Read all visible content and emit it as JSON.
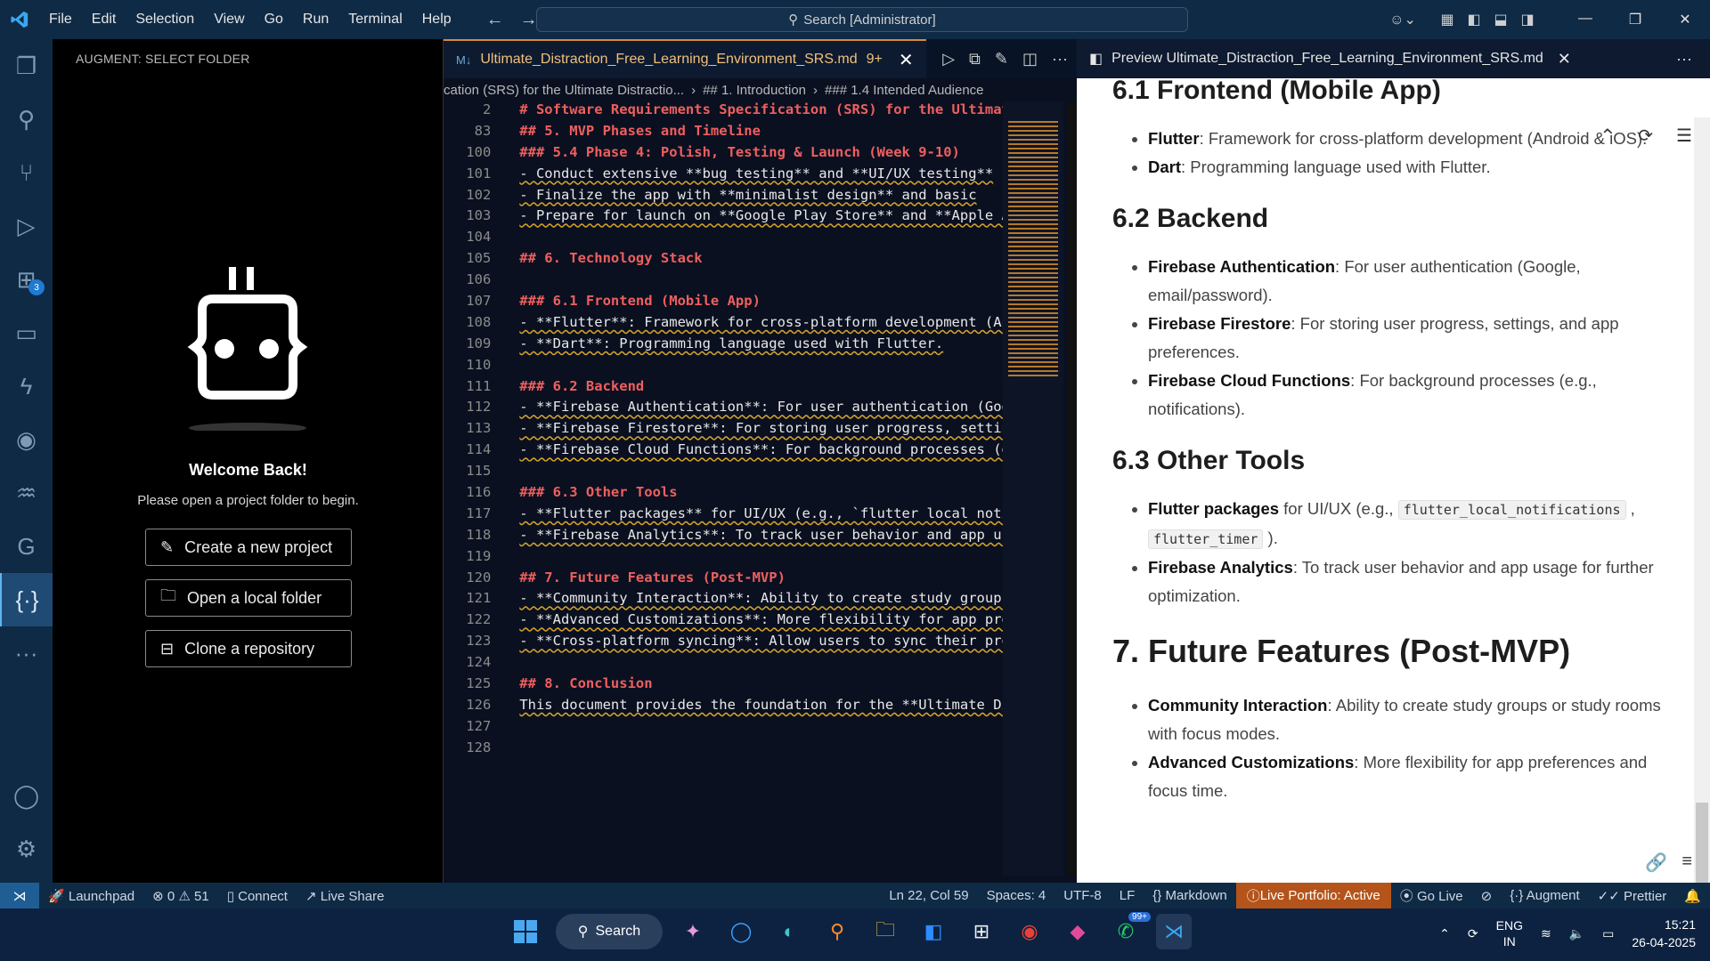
{
  "titlebar": {
    "menu": [
      "File",
      "Edit",
      "Selection",
      "View",
      "Go",
      "Run",
      "Terminal",
      "Help"
    ],
    "search": "Search [Administrator]"
  },
  "activity": {
    "extensions_badge": "3"
  },
  "sidebar": {
    "title": "AUGMENT: SELECT FOLDER",
    "welcome": "Welcome Back!",
    "subtitle": "Please open a project folder to begin.",
    "buttons": [
      "Create a new project",
      "Open a local folder",
      "Clone a repository"
    ]
  },
  "editor": {
    "tab_label": "Ultimate_Distraction_Free_Learning_Environment_SRS.md",
    "tab_count": "9+",
    "breadcrumb": [
      "cation (SRS) for the Ultimate Distractio...",
      "## 1. Introduction",
      "### 1.4 Intended Audience"
    ],
    "lines": [
      {
        "n": "2",
        "t": "# Software Requirements Specification (SRS) for the Ultimate Di",
        "h": true
      },
      {
        "n": "83",
        "t": "## 5. MVP Phases and Timeline",
        "h": true
      },
      {
        "n": "100",
        "t": "### 5.4 Phase 4: Polish, Testing & Launch (Week 9-10)",
        "h": true
      },
      {
        "n": "101",
        "t": "- Conduct extensive **bug testing** and **UI/UX testing**",
        "h": false
      },
      {
        "n": "102",
        "t": "- Finalize the app with **minimalist design** and basic",
        "h": false
      },
      {
        "n": "103",
        "t": "- Prepare for launch on **Google Play Store** and **Apple App S",
        "h": false
      },
      {
        "n": "104",
        "t": "",
        "h": false
      },
      {
        "n": "105",
        "t": "## 6. Technology Stack",
        "h": true
      },
      {
        "n": "106",
        "t": "",
        "h": false
      },
      {
        "n": "107",
        "t": "### 6.1 Frontend (Mobile App)",
        "h": true
      },
      {
        "n": "108",
        "t": "- **Flutter**: Framework for cross-platform development (Androi",
        "h": false
      },
      {
        "n": "109",
        "t": "- **Dart**: Programming language used with Flutter.",
        "h": false
      },
      {
        "n": "110",
        "t": "",
        "h": false
      },
      {
        "n": "111",
        "t": "### 6.2 Backend",
        "h": true
      },
      {
        "n": "112",
        "t": "- **Firebase Authentication**: For user authentication (Google,",
        "h": false
      },
      {
        "n": "113",
        "t": "- **Firebase Firestore**: For storing user progress, settings,",
        "h": false
      },
      {
        "n": "114",
        "t": "- **Firebase Cloud Functions**: For background processes (e.g.,",
        "h": false
      },
      {
        "n": "115",
        "t": "",
        "h": false
      },
      {
        "n": "116",
        "t": "### 6.3 Other Tools",
        "h": true
      },
      {
        "n": "117",
        "t": "- **Flutter packages** for UI/UX (e.g., `flutter local notifica",
        "h": false
      },
      {
        "n": "118",
        "t": "- **Firebase Analytics**: To track user behavior and app usage",
        "h": false
      },
      {
        "n": "119",
        "t": "",
        "h": false
      },
      {
        "n": "120",
        "t": "## 7. Future Features (Post-MVP)",
        "h": true
      },
      {
        "n": "121",
        "t": "- **Community Interaction**: Ability to create study groups or",
        "h": false
      },
      {
        "n": "122",
        "t": "- **Advanced Customizations**: More flexibility for app prefere",
        "h": false
      },
      {
        "n": "123",
        "t": "- **Cross-platform syncing**: Allow users to sync their progres",
        "h": false
      },
      {
        "n": "124",
        "t": "",
        "h": false
      },
      {
        "n": "125",
        "t": "## 8. Conclusion",
        "h": true
      },
      {
        "n": "126",
        "t": "This document provides the foundation for the **Ultimate Distra",
        "h": false
      },
      {
        "n": "127",
        "t": "",
        "h": false
      },
      {
        "n": "128",
        "t": "",
        "h": false
      }
    ]
  },
  "preview": {
    "tab_label": "Preview Ultimate_Distraction_Free_Learning_Environment_SRS.md",
    "h_61": "6.1 Frontend (Mobile App)",
    "frontend": [
      {
        "b": "Flutter",
        "t": ": Framework for cross-platform development (Android & iOS)."
      },
      {
        "b": "Dart",
        "t": ": Programming language used with Flutter."
      }
    ],
    "h_62": "6.2 Backend",
    "backend": [
      {
        "b": "Firebase Authentication",
        "t": ": For user authentication (Google, email/password)."
      },
      {
        "b": "Firebase Firestore",
        "t": ": For storing user progress, settings, and app preferences."
      },
      {
        "b": "Firebase Cloud Functions",
        "t": ": For background processes (e.g., notifications)."
      }
    ],
    "h_63": "6.3 Other Tools",
    "tools_1_b": "Flutter packages",
    "tools_1_t": " for UI/UX (e.g., ",
    "tools_1_code1": "flutter_local_notifications",
    "tools_1_sep": " , ",
    "tools_1_code2": "flutter_timer",
    "tools_1_end": " ).",
    "tools_2_b": "Firebase Analytics",
    "tools_2_t": ": To track user behavior and app usage for further optimization.",
    "h_7": "7. Future Features (Post-MVP)",
    "future": [
      {
        "b": "Community Interaction",
        "t": ": Ability to create study groups or study rooms with focus modes."
      },
      {
        "b": "Advanced Customizations",
        "t": ": More flexibility for app preferences and focus time."
      }
    ]
  },
  "status": {
    "launchpad": "Launchpad",
    "problems": "0",
    "warnings": "51",
    "connect": "Connect",
    "liveshare": "Live Share",
    "position": "Ln 22, Col 59",
    "spaces": "Spaces: 4",
    "encoding": "UTF-8",
    "eol": "LF",
    "language": "Markdown",
    "portfolio": "Live Portfolio: Active",
    "golive": "Go Live",
    "augment": "Augment",
    "prettier": "Prettier"
  },
  "taskbar": {
    "search": "Search",
    "whatsapp_badge": "99+",
    "lang1": "ENG",
    "lang2": "IN",
    "time": "15:21",
    "date": "26-04-2025"
  }
}
